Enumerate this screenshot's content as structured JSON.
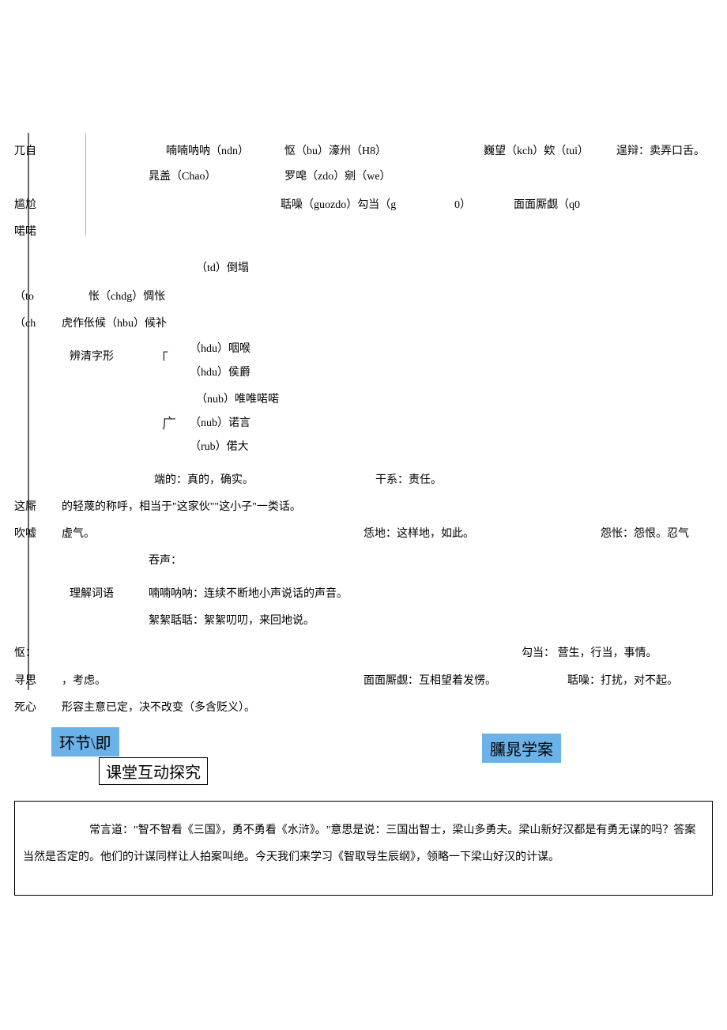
{
  "row1": {
    "a": "兀自",
    "b": "喃喃呐呐（ndn）",
    "c": "怄（bu）濠州（H8）",
    "d": "巍望（kch）欸（tui）",
    "e": "逞辩：卖弄口舌。"
  },
  "row2": {
    "a": "晁盖（Chao）",
    "b": "罗唣（zdo）剜（we）"
  },
  "row3": {
    "a": "尴尬",
    "b": "聒噪（guozdo）勾当（g",
    "c": "0）",
    "d": "面面厮觑（q0"
  },
  "row4": {
    "a": "喏喏"
  },
  "row5": {
    "a": "（td）倒塌"
  },
  "row6": {
    "a": "（to",
    "b": "怅（chdg）惆怅"
  },
  "row7": {
    "a": "（ch",
    "b": "虎作伥候（hbu）候补"
  },
  "sec1_label": "辨清字形",
  "g1": "（hdu）咽喉",
  "g2": "（hdu）侯爵",
  "g3": "（nub）唯唯喏喏",
  "g4": "（nub）诺言",
  "g5": "（rub）偌大",
  "brk": "「",
  "brk2": "广",
  "def1a": "端的：真的，确实。",
  "def1b": "干系：责任。",
  "def2": "这厮",
  "def2b": "的轻蔑的称呼，相当于\"这家伙\"\"这小子\"一类话。",
  "def3a": "吹嘘",
  "def3b": "虚气。",
  "def3c": "恁地：这样地，如此。",
  "def3d": "怨怅：怨恨。忍气",
  "def4": "吞声：",
  "sec2_label": "理解词语",
  "v1": "喃喃呐呐：连续不断地小声说话的声音。",
  "v2": "絮絮聒聒：絮絮叨叨，来回地说。",
  "w1a": "怄：",
  "w1b": "勾当：  营生，行当，事情。",
  "w2a": "寻思",
  "w2b": "，考虑。",
  "w2c": "面面厮觑：互相望着发愣。",
  "w2d": "聒噪：打扰，对不起。",
  "w3a": "死心",
  "w3b": "形容主意已定，决不改变（多含贬义）。",
  "tab1": "环节\\即",
  "tab2": "臐晁学案",
  "box_title": "课堂互动探究",
  "para": "常言道：\"智不智看《三国》，勇不勇看《水浒》。\"意思是说：三国出智士，梁山多勇夫。梁山新好汉都是有勇无谋的吗？答案当然是否定的。他们的计谋同样让人拍案叫绝。今天我们来学习《智取导生辰纲》，领略一下梁山好汉的计谋。"
}
